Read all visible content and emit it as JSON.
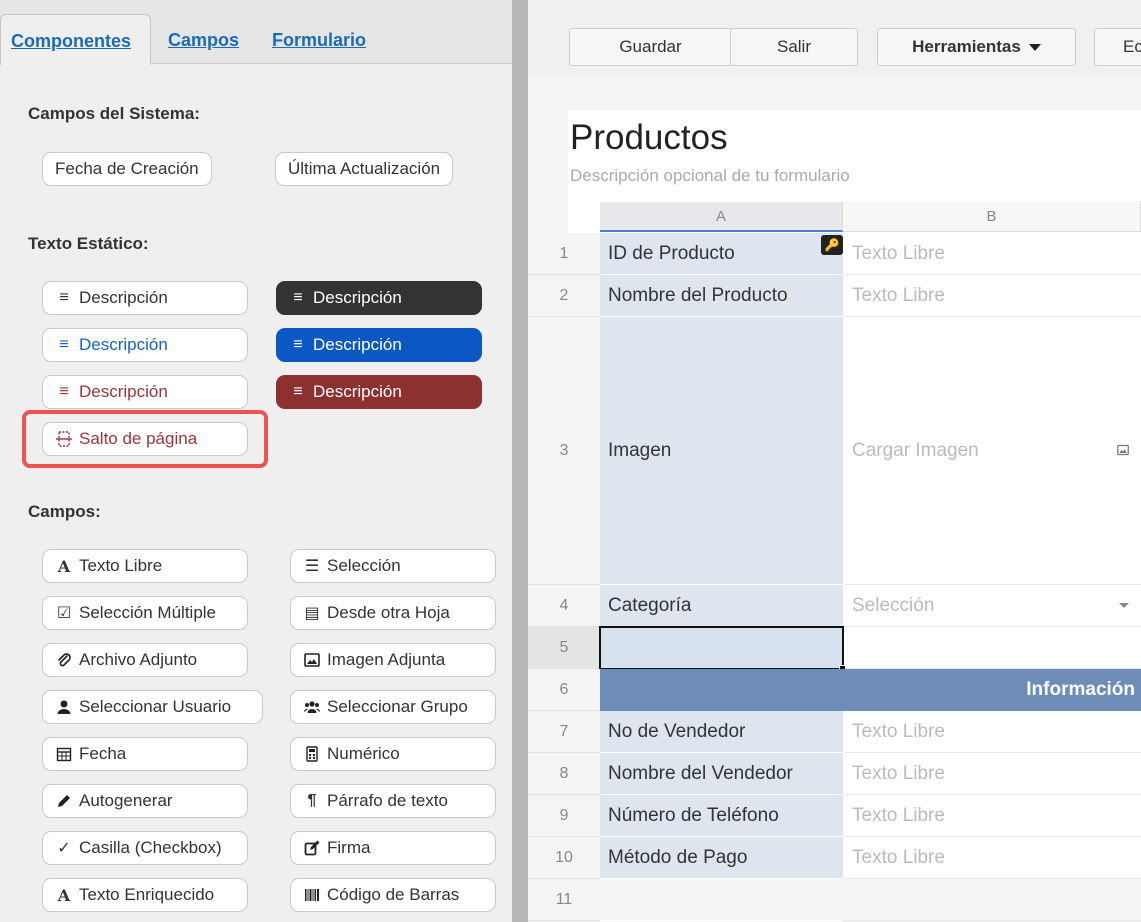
{
  "tabs": {
    "components": "Componentes",
    "fields": "Campos",
    "form": "Formulario"
  },
  "system_fields": {
    "title": "Campos del Sistema:",
    "created": "Fecha de Creación",
    "updated": "Última Actualización"
  },
  "static_text": {
    "title": "Texto Estático:",
    "description": "Descripción",
    "page_break": "Salto de página"
  },
  "fields": {
    "title": "Campos:",
    "items": [
      "Texto Libre",
      "Selección",
      "Selección Múltiple",
      "Desde otra Hoja",
      "Archivo Adjunto",
      "Imagen Adjunta",
      "Seleccionar Usuario",
      "Seleccionar Grupo",
      "Fecha",
      "Numérico",
      "Autogenerar",
      "Párrafo de texto",
      "Casilla (Checkbox)",
      "Firma",
      "Texto Enriquecido",
      "Código de Barras"
    ]
  },
  "toolbar": {
    "save": "Guardar",
    "exit": "Salir",
    "tools": "Herramientas",
    "edit_partial": "Ec"
  },
  "form": {
    "title": "Productos",
    "description": "Descripción opcional de tu formulario"
  },
  "grid": {
    "col_a": "A",
    "col_b": "B",
    "rows": [
      {
        "n": "1",
        "a": "ID de Producto",
        "b": "Texto Libre"
      },
      {
        "n": "2",
        "a": "Nombre del Producto",
        "b": "Texto Libre"
      },
      {
        "n": "3",
        "a": "Imagen",
        "b": "Cargar Imagen"
      },
      {
        "n": "4",
        "a": "Categoría",
        "b": "Selección"
      },
      {
        "n": "5",
        "a": "",
        "b": ""
      },
      {
        "n": "6",
        "a": "Información",
        "b": ""
      },
      {
        "n": "7",
        "a": "No de Vendedor",
        "b": "Texto Libre"
      },
      {
        "n": "8",
        "a": "Nombre del Vendedor",
        "b": "Texto Libre"
      },
      {
        "n": "9",
        "a": "Número de Teléfono",
        "b": "Texto Libre"
      },
      {
        "n": "10",
        "a": "Método de Pago",
        "b": "Texto Libre"
      },
      {
        "n": "11",
        "a": "",
        "b": ""
      }
    ]
  },
  "colors": {
    "accent_blue": "#0b58c4",
    "dark": "#333333",
    "dark_red": "#8c3030",
    "highlight": "#ef5350",
    "section_bar": "#6e8cb8"
  }
}
